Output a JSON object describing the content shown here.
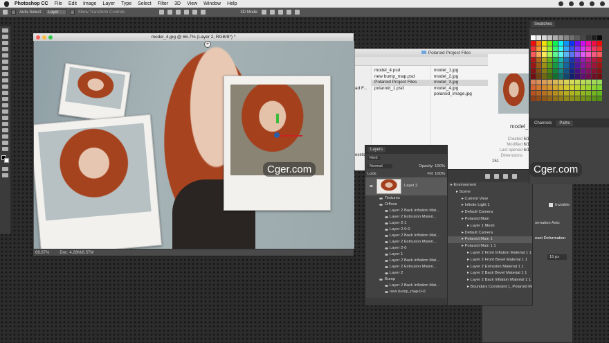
{
  "menubar": {
    "app": "Photoshop CC",
    "items": [
      "File",
      "Edit",
      "Image",
      "Layer",
      "Type",
      "Select",
      "Filter",
      "3D",
      "View",
      "Window",
      "Help"
    ]
  },
  "options": {
    "auto_select": "Auto-Select:",
    "layer": "Layer",
    "transform": "Show Transform Controls",
    "mode3d": "3D Mode:"
  },
  "document": {
    "title": "model_4.jpg @ 66.7% (Layer 2, RGB/8*) *",
    "zoom": "66.67%",
    "doc": "Doc: 4.28M/8.57M"
  },
  "finder": {
    "title": "Polaroid Project Files",
    "col1": [
      "model_4.psd",
      "new bump_map.psd",
      "Polaroid Project Files",
      "polaroid_1.psd"
    ],
    "col2": [
      "model_1.jpg",
      "model_2.jpg",
      "model_3.jpg",
      "model_4.jpg",
      "polaroid_image.jpg"
    ],
    "left_frag": [
      "ad F..."
    ],
    "presets": "esets",
    "info": {
      "name": "model_",
      "labels": [
        "Created",
        "Modified",
        "Last opened",
        "Dimensions"
      ],
      "vals": [
        "6/1",
        "6/1",
        "6/1",
        "151"
      ]
    }
  },
  "layers": {
    "tab": "Layers",
    "kind": "Kind",
    "blend": "Normal",
    "opacity_label": "Opacity:",
    "opacity": "100%",
    "lock": "Lock:",
    "fill_label": "Fill:",
    "fill": "100%",
    "layer": "Layer 2",
    "rows": [
      {
        "t": "Textures",
        "i": 1
      },
      {
        "t": "Diffuse",
        "i": 1
      },
      {
        "t": "Layer 2 Back Inflation Mat...",
        "i": 2
      },
      {
        "t": "Layer 2 Extrusion Materi...",
        "i": 2
      },
      {
        "t": "Layer 2-1",
        "i": 2
      },
      {
        "t": "Layer 2-0-0",
        "i": 2
      },
      {
        "t": "Layer 2 Back Inflation Mat...",
        "i": 2
      },
      {
        "t": "Layer 2 Extrusion Materi...",
        "i": 2
      },
      {
        "t": "Layer 2-0",
        "i": 2
      },
      {
        "t": "Layer 1",
        "i": 2
      },
      {
        "t": "Layer 2 Back Inflation Mat...",
        "i": 2
      },
      {
        "t": "Layer 2 Extrusion Materi...",
        "i": 2
      },
      {
        "t": "Layer 2",
        "i": 2
      },
      {
        "t": "Bump",
        "i": 1
      },
      {
        "t": "Layer 2 Back Inflation Mat...",
        "i": 2
      },
      {
        "t": "new bump_map-0-0",
        "i": 2
      }
    ]
  },
  "scene": {
    "rows": [
      "Environment",
      "Scene",
      "Current View",
      "Infinite Light 1",
      "Default Camera",
      "Polaroid Main",
      "Layer 1 Mesh",
      "Default Camera",
      "Polaroid Main 1",
      "Polaroid Main 1 1",
      "Layer 2 Front Inflation Material 1 1",
      "Layer 2 Front Bevel Material 1 1",
      "Layer 2 Extrusion Material 1 1",
      "Layer 2 Back Bevel Material 1 1",
      "Layer 2 Back Inflation Material 1 1",
      "Boundary Constraint 1_Polaroid Mai..."
    ]
  },
  "props": {
    "invisible": "Invisible",
    "axis": "ormation Axis:",
    "reset": "eset Deformation",
    "px": "15 px"
  },
  "swatches": {
    "title": "Swatches"
  },
  "channels": {
    "tab1": "Channels",
    "tab2": "Paths"
  },
  "watermark": "Cger.com",
  "colors": {
    "menubar": "#e9e9e9",
    "panel": "#424242",
    "accent": "#2a5fa8"
  }
}
